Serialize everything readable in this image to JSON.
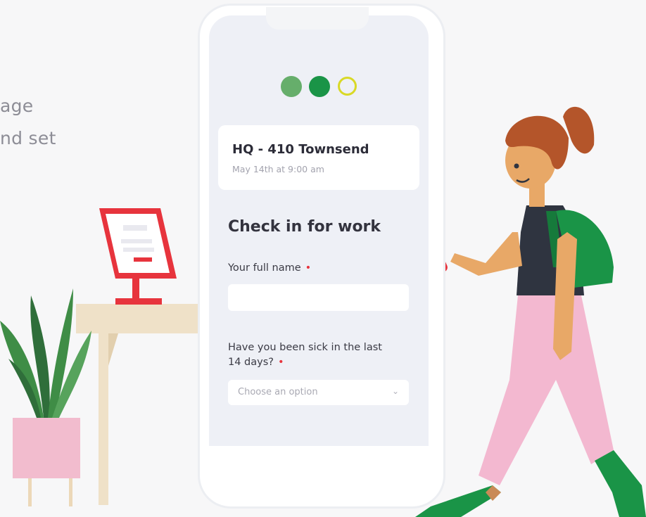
{
  "background_text": {
    "line1": "age",
    "line2": "nd set"
  },
  "colors": {
    "accent_red": "#e7343d",
    "dot_light": "#66ae6b",
    "dot_dark": "#1a9447",
    "dot_outline": "#d9d926"
  },
  "location_card": {
    "title": "HQ - 410 Townsend",
    "subtitle": "May 14th at 9:00 am"
  },
  "form": {
    "title": "Check in for work",
    "name_label": "Your full name",
    "name_required": "•",
    "name_value": "",
    "sick_label_line1": "Have you been sick in the last",
    "sick_label_line2": "14 days?",
    "sick_required": "•",
    "sick_select_placeholder": "Choose an option",
    "sick_select_icon": "chevron-down-icon"
  }
}
